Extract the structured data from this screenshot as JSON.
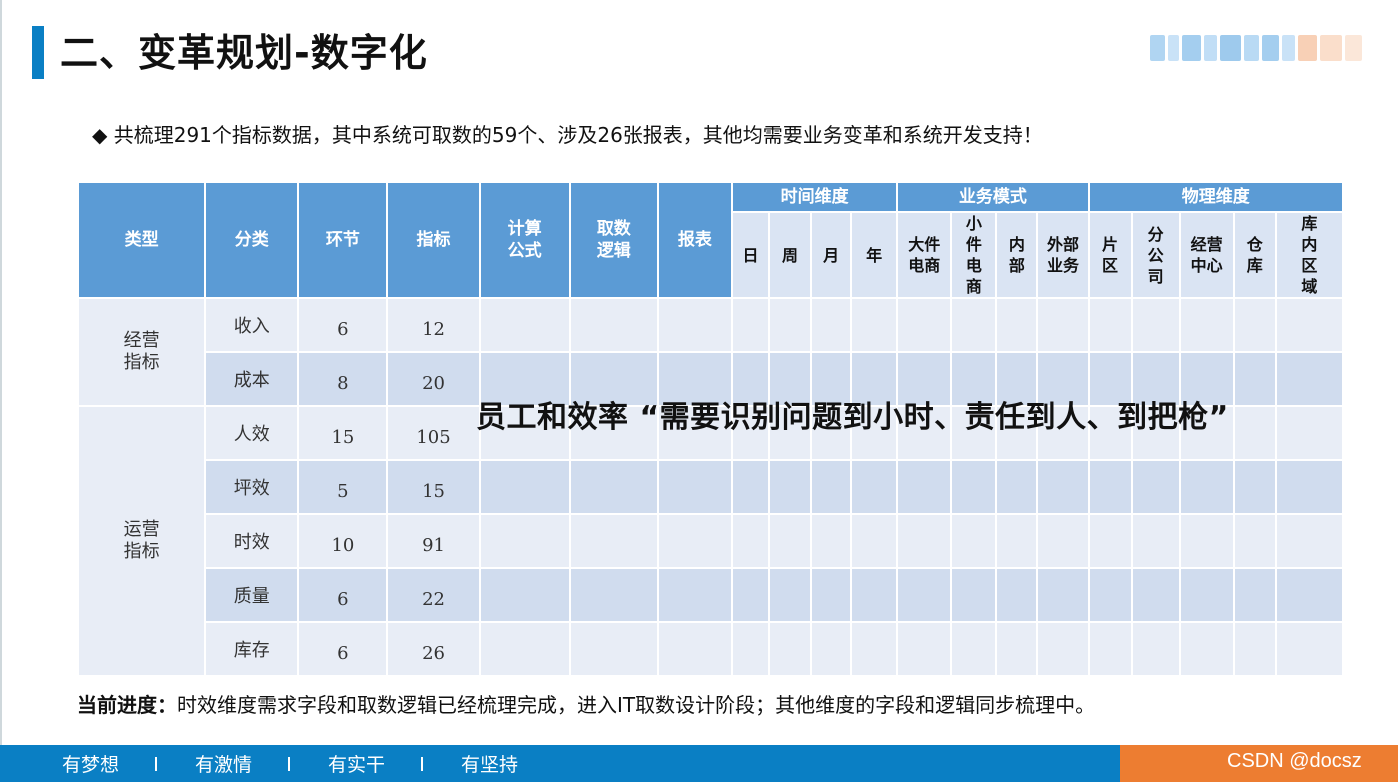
{
  "slide": {
    "title": "二、变革规划-数字化",
    "bullet": "◆ 共梳理291个指标数据，其中系统可取数的59个、涉及26张报表，其他均需要业务变革和系统开发支持！",
    "overlay": "员工和效率 “需要识别问题到小时、责任到人、到把枪”",
    "progress_label": "当前进度：",
    "progress_text": "时效维度需求字段和取数逻辑已经梳理完成，进入IT取数设计阶段；其他维度的字段和逻辑同步梳理中。",
    "colors": {
      "accent": "#0a7fc4",
      "header": "#5b9bd5",
      "footer_accent": "#ed7d31"
    }
  },
  "table": {
    "headers": {
      "type": "类型",
      "category": "分类",
      "link": "环节",
      "indicator": "指标",
      "formula": "计算公式",
      "logic": "取数逻辑",
      "report": "报表",
      "time_group": "时间维度",
      "business_group": "业务模式",
      "physical_group": "物理维度"
    },
    "time_cols": [
      "日",
      "周",
      "月",
      "年"
    ],
    "business_cols": [
      "大件电商",
      "小件电商",
      "内部",
      "外部业务"
    ],
    "physical_cols": [
      "片区",
      "分公司",
      "经营中心",
      "仓库",
      "库内区域"
    ],
    "groups": [
      {
        "type": "经营指标",
        "rows": [
          {
            "category": "收入",
            "link": "6",
            "indicator": "12"
          },
          {
            "category": "成本",
            "link": "8",
            "indicator": "20"
          }
        ]
      },
      {
        "type": "运营指标",
        "rows": [
          {
            "category": "人效",
            "link": "15",
            "indicator": "105"
          },
          {
            "category": "坪效",
            "link": "5",
            "indicator": "15"
          },
          {
            "category": "时效",
            "link": "10",
            "indicator": "91"
          },
          {
            "category": "质量",
            "link": "6",
            "indicator": "22"
          },
          {
            "category": "库存",
            "link": "6",
            "indicator": "26"
          }
        ]
      }
    ]
  },
  "footer": {
    "slogans": [
      "有梦想",
      "有激情",
      "有实干",
      "有坚持"
    ],
    "watermark": "CSDN @docsz"
  }
}
